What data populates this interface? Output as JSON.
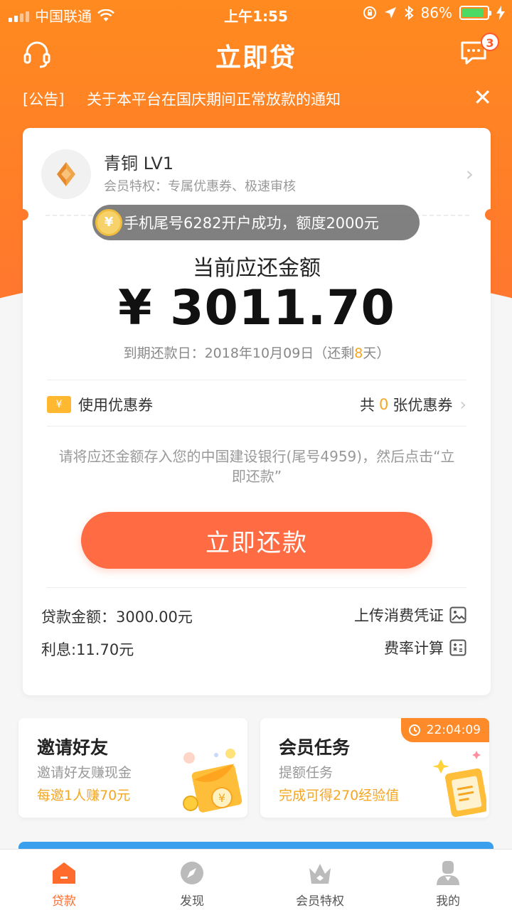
{
  "status_bar": {
    "carrier": "中国联通",
    "time": "上午1:55",
    "battery": "86%"
  },
  "nav": {
    "title": "立即贷",
    "message_badge": "3"
  },
  "notice": {
    "tag": "[公告]",
    "message": "关于本平台在国庆期间正常放款的通知"
  },
  "member": {
    "level": "青铜 LV1",
    "perks": "会员特权：专属优惠券、极速审核"
  },
  "toast": {
    "coin": "¥",
    "text": "手机尾号6282开户成功，额度2000元"
  },
  "repayment": {
    "label": "当前应还金额",
    "amount": "¥ 3011.70",
    "due_prefix": "到期还款日：2018年10月09日（还剩",
    "days_left": "8",
    "due_suffix": "天）"
  },
  "coupon": {
    "label": "使用优惠券",
    "prefix": "共",
    "count": "0",
    "suffix": "张优惠券"
  },
  "instruction": "请将应还金额存入您的中国建设银行(尾号4959)，然后点击“立即还款”",
  "repay_button": "立即还款",
  "loan": {
    "amount": "贷款金额：3000.00元",
    "interest": "利息:11.70元",
    "upload": "上传消费凭证",
    "calc": "费率计算"
  },
  "promo": {
    "invite": {
      "title": "邀请好友",
      "sub": "邀请好友赚现金",
      "highlight": "每邀1人赚70元"
    },
    "tasks": {
      "title": "会员任务",
      "sub": "提额任务",
      "highlight": "完成可得270经验值",
      "timer": "22:04:09"
    }
  },
  "tabs": [
    {
      "label": "贷款",
      "icon": "home-icon"
    },
    {
      "label": "发现",
      "icon": "compass-icon"
    },
    {
      "label": "会员特权",
      "icon": "crown-icon"
    },
    {
      "label": "我的",
      "icon": "user-icon"
    }
  ],
  "colors": {
    "brand": "#ff7a2b",
    "button": "#ff6b42",
    "highlight": "#f5a623"
  }
}
